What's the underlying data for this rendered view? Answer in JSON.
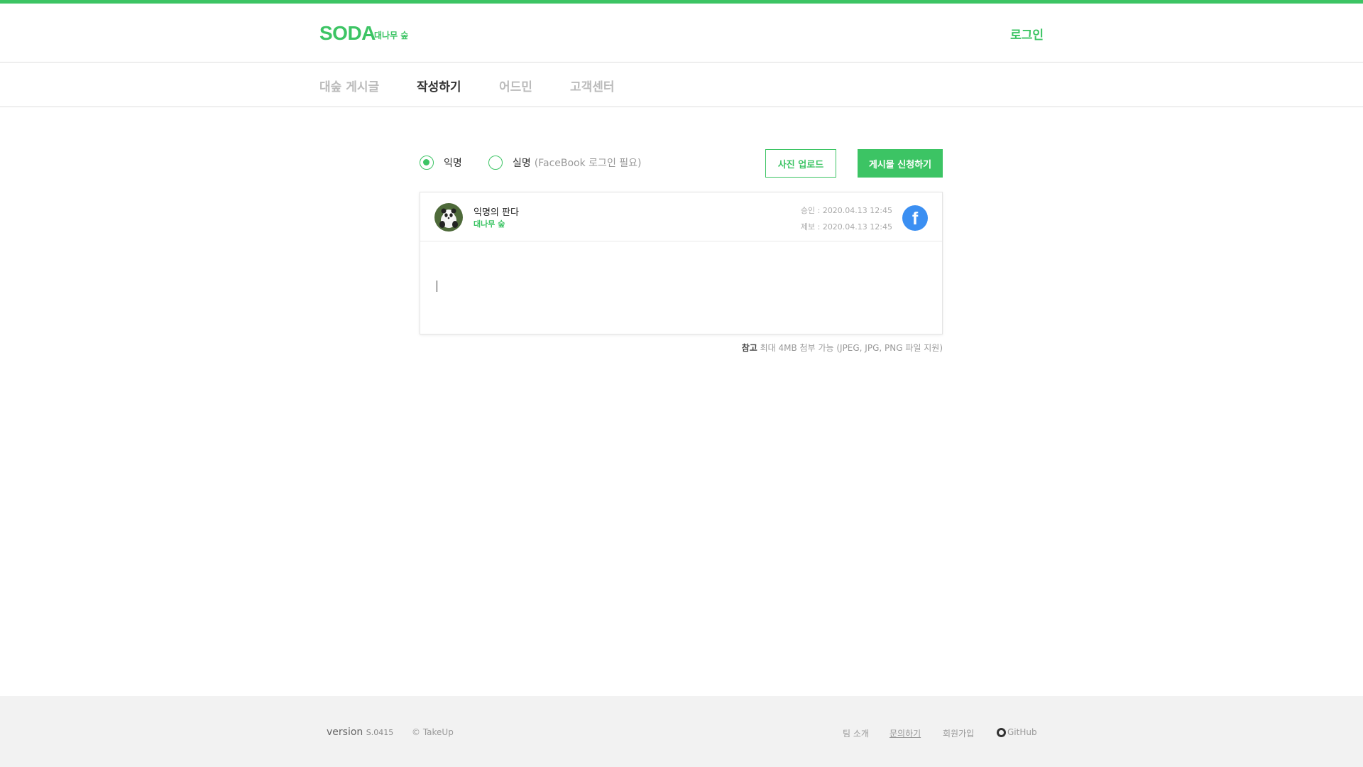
{
  "colors": {
    "accent": "#3cc464",
    "facebook": "#3b8ff2",
    "panda_bg": "#4e6a3a"
  },
  "header": {
    "logo": "SODA",
    "logo_sub": "대나무 숲",
    "login_label": "로그인"
  },
  "nav": {
    "items": [
      {
        "label": "대숲 게시글"
      },
      {
        "label": "작성하기"
      },
      {
        "label": "어드민"
      },
      {
        "label": "고객센터"
      }
    ]
  },
  "form": {
    "anonymous_label": "익명",
    "realname_label": "실명",
    "realname_note": "(FaceBook 로그인 필요)",
    "selected": "익명",
    "upload_label": "사진 업로드",
    "submit_label": "게시물 신청하기"
  },
  "post": {
    "avatar_icon": "panda-avatar",
    "author": "익명의 판다",
    "author_sub": "대나무 숲",
    "approved": "승인 : 2020.04.13 12:45",
    "submitted": "제보 : 2020.04.13 12:45",
    "share_icon": "facebook-icon",
    "content": ""
  },
  "note": {
    "label": "참고",
    "text": "최대 4MB 첨부 가능 (JPEG, JPG, PNG 파일 지원)"
  },
  "footer": {
    "version_label": "version",
    "version_value": "S.0415",
    "copyright": "© TakeUp",
    "links": [
      "팀 소개",
      "문의하기",
      "회원가입"
    ],
    "github_label": "GitHub",
    "github_icon": "github-icon"
  }
}
